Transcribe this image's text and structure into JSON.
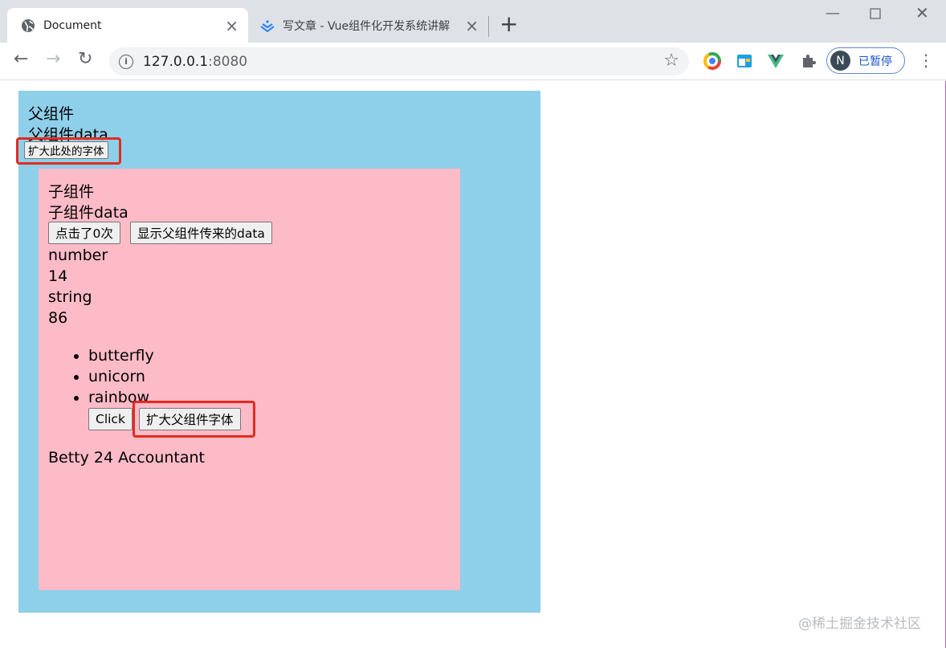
{
  "browser": {
    "tabs": [
      {
        "title": "Document",
        "active": true
      },
      {
        "title": "写文章 - Vue组件化开发系统讲解",
        "active": false
      }
    ],
    "new_tab_label": "+",
    "address": {
      "host": "127.0.0.1",
      "port": ":8080"
    },
    "profile": {
      "initial": "N",
      "status": "已暂停"
    }
  },
  "parent": {
    "title": "父组件",
    "data_text": "父组件data",
    "enlarge_button": "扩大此处的字体"
  },
  "child": {
    "title": "子组件",
    "data_text": "子组件data",
    "click_count_button": "点击了0次",
    "show_parent_data_button": "显示父组件传来的data",
    "type_number": "number",
    "value_number": "14",
    "type_string": "string",
    "value_string": "86",
    "list": [
      "butterfly",
      "unicorn",
      "rainbow"
    ],
    "click_button": "Click",
    "enlarge_parent_button": "扩大父组件字体",
    "person": "Betty 24 Accountant"
  },
  "watermark": "@稀土掘金技术社区",
  "colors": {
    "parent_bg": "#8ecfea",
    "child_bg": "#fdbbc8",
    "highlight": "#e32b1f"
  }
}
